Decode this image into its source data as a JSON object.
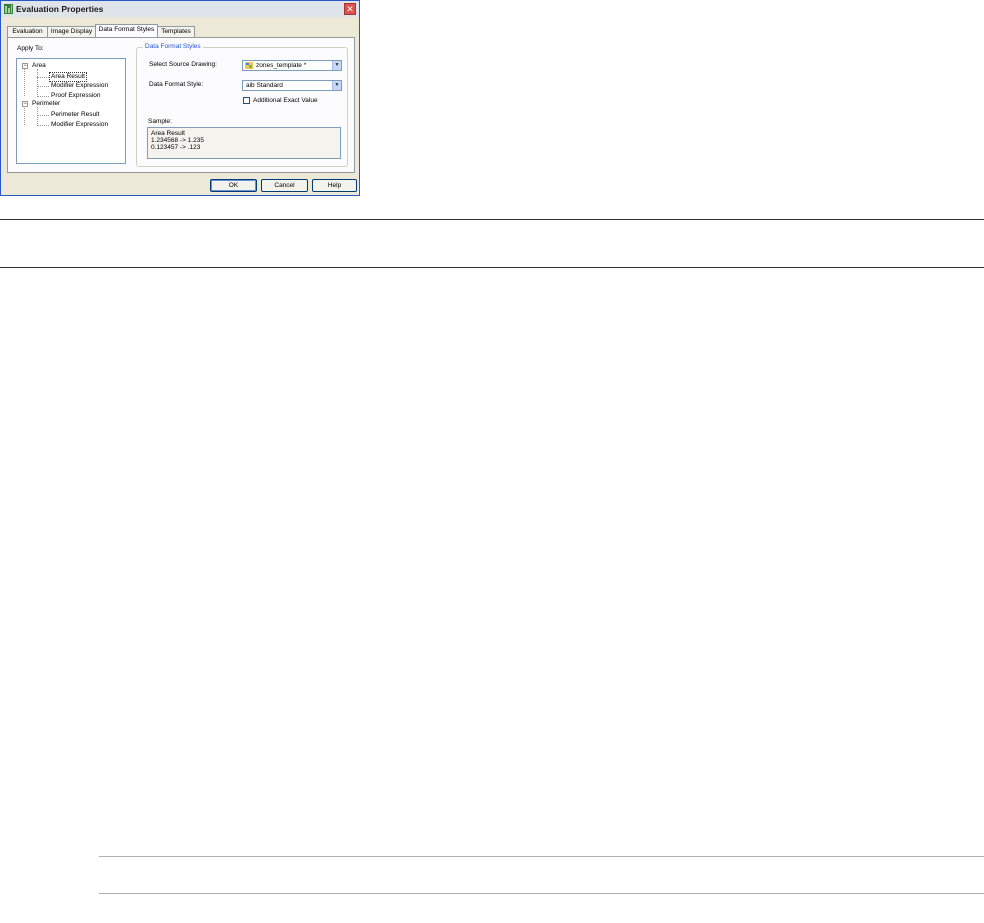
{
  "dialog": {
    "title": "Evaluation Properties",
    "close_glyph": "✕",
    "tabs": [
      {
        "label": "Evaluation",
        "active": false
      },
      {
        "label": "Image Display",
        "active": false
      },
      {
        "label": "Data Format Styles",
        "active": true
      },
      {
        "label": "Templates",
        "active": false
      }
    ],
    "apply_to_label": "Apply To:",
    "tree": {
      "expander_glyph": "−",
      "groups": [
        {
          "label": "Area",
          "children": [
            "Area Result",
            "Modifier Expression",
            "Proof Expression"
          ]
        },
        {
          "label": "Perimeter",
          "children": [
            "Perimeter Result",
            "Modifier Expression"
          ]
        }
      ],
      "selected": "Area Result"
    },
    "group_title": "Data Format Styles",
    "source_drawing": {
      "label": "Select Source Drawing:",
      "value": "zones_template *",
      "icon": "drawing-icon"
    },
    "format_style": {
      "label": "Data Format Style:",
      "value": "aib Standard"
    },
    "additional_exact": {
      "label": "Additional Exact Value",
      "checked": false
    },
    "sample": {
      "label": "Sample:",
      "lines": [
        "Area Result",
        "1.234568 -> 1.235",
        "0.123457 -> .123"
      ]
    },
    "buttons": {
      "ok": "OK",
      "cancel": "Cancel",
      "help": "Help"
    }
  },
  "colors": {
    "accent": "#2255cc",
    "dialog_bg": "#ece9d8",
    "panel_bg": "#fcfcfe"
  }
}
